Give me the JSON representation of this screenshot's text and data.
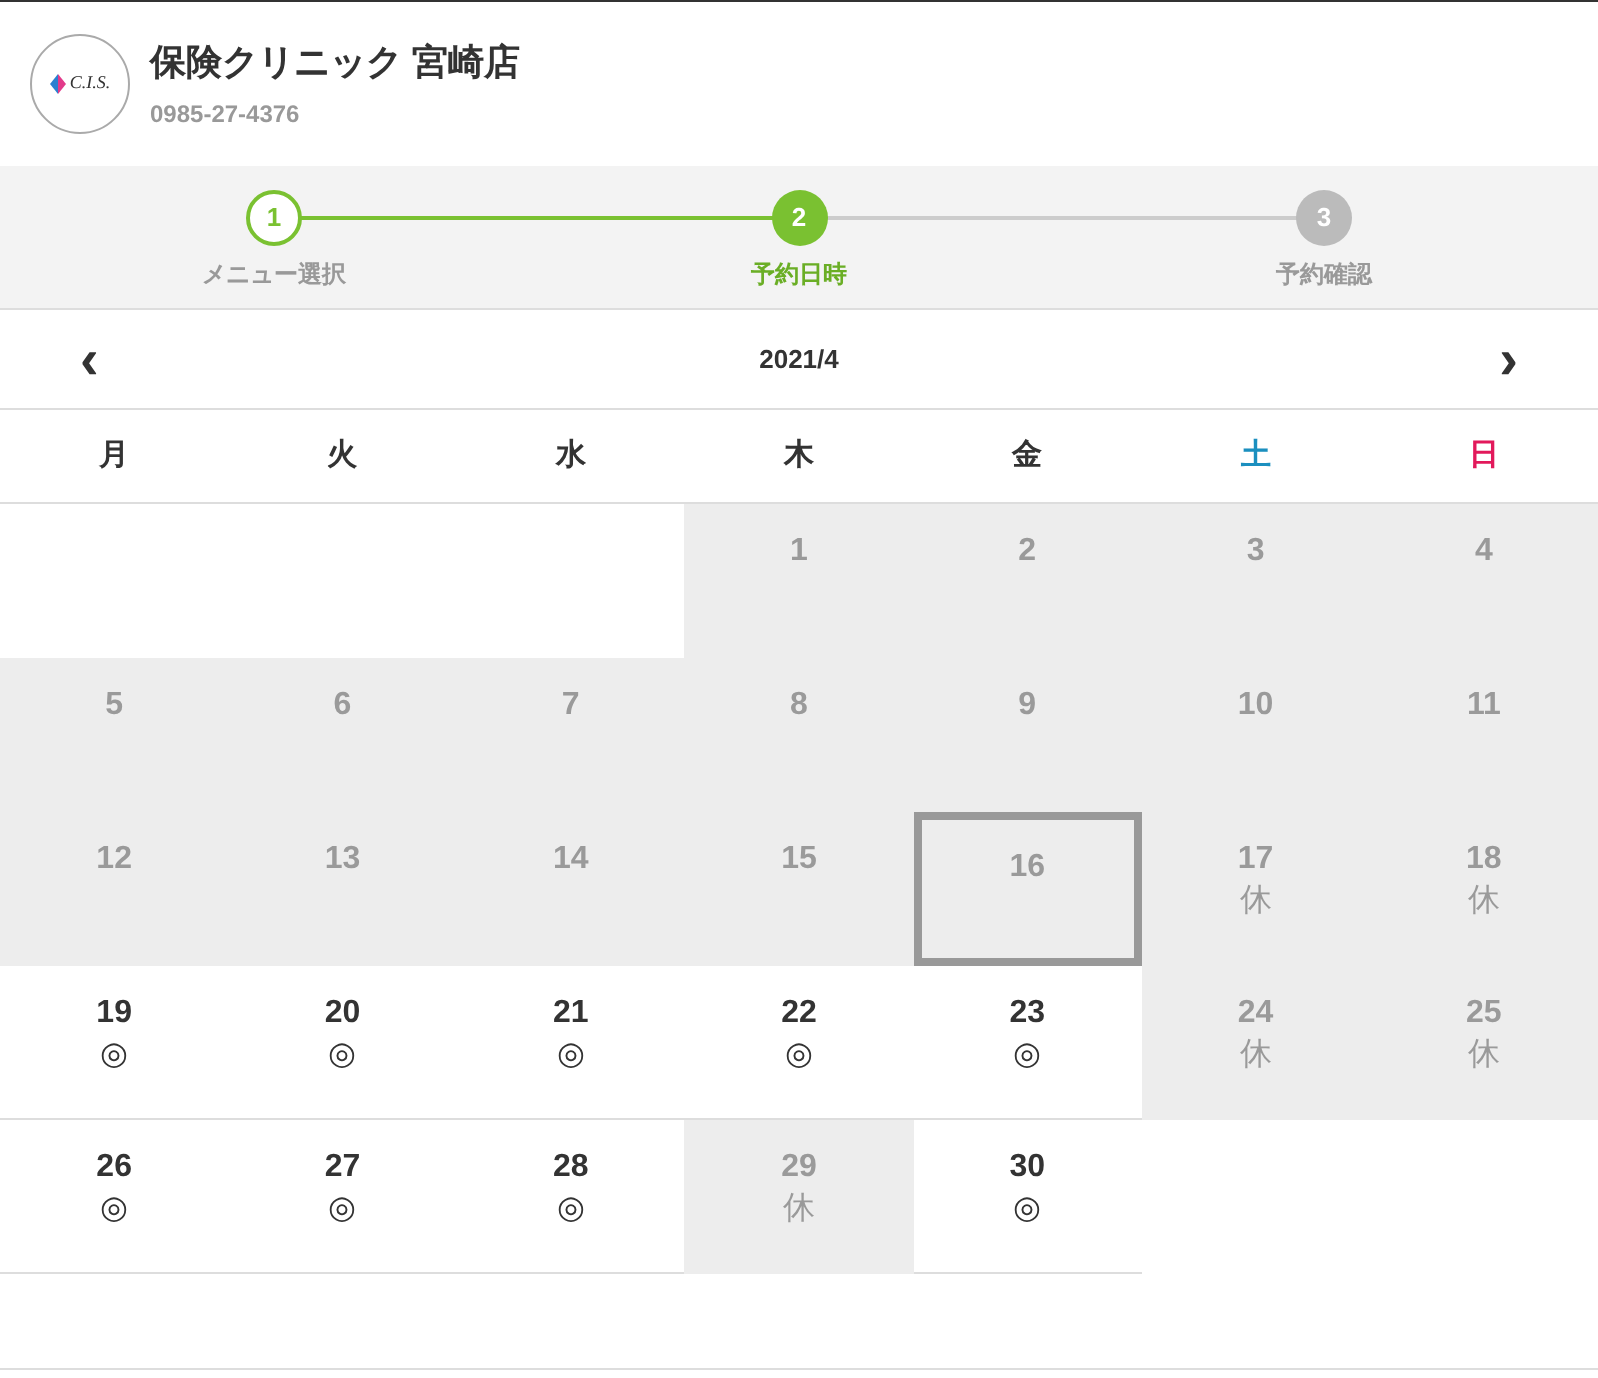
{
  "header": {
    "logo_text": "C.I.S.",
    "title": "保険クリニック 宮崎店",
    "phone": "0985-27-4376"
  },
  "steps": [
    {
      "number": "1",
      "label": "メニュー選択",
      "done": true,
      "selected": false
    },
    {
      "number": "2",
      "label": "予約日時",
      "done": false,
      "selected": true
    },
    {
      "number": "3",
      "label": "予約確認",
      "done": false,
      "selected": false
    }
  ],
  "month": {
    "prev": "‹",
    "label": "2021/4",
    "next": "›"
  },
  "weekdays": [
    {
      "label": "月",
      "kind": "weekday"
    },
    {
      "label": "火",
      "kind": "weekday"
    },
    {
      "label": "水",
      "kind": "weekday"
    },
    {
      "label": "木",
      "kind": "weekday"
    },
    {
      "label": "金",
      "kind": "weekday"
    },
    {
      "label": "土",
      "kind": "saturday"
    },
    {
      "label": "日",
      "kind": "sunday"
    }
  ],
  "weeks": [
    [
      {
        "kind": "empty"
      },
      {
        "kind": "empty"
      },
      {
        "kind": "empty"
      },
      {
        "kind": "closed",
        "day": "1",
        "today": false
      },
      {
        "kind": "closed",
        "day": "2",
        "today": false
      },
      {
        "kind": "closed",
        "day": "3",
        "today": false
      },
      {
        "kind": "closed",
        "day": "4",
        "today": false
      }
    ],
    [
      {
        "kind": "closed",
        "day": "5",
        "today": false
      },
      {
        "kind": "closed",
        "day": "6",
        "today": false
      },
      {
        "kind": "closed",
        "day": "7",
        "today": false
      },
      {
        "kind": "closed",
        "day": "8",
        "today": false
      },
      {
        "kind": "closed",
        "day": "9",
        "today": false
      },
      {
        "kind": "closed",
        "day": "10",
        "today": false
      },
      {
        "kind": "closed",
        "day": "11",
        "today": false
      }
    ],
    [
      {
        "kind": "closed",
        "day": "12",
        "today": false
      },
      {
        "kind": "closed",
        "day": "13",
        "today": false
      },
      {
        "kind": "closed",
        "day": "14",
        "today": false
      },
      {
        "kind": "closed",
        "day": "15",
        "today": false
      },
      {
        "kind": "closed",
        "day": "16",
        "today": true
      },
      {
        "kind": "holiday",
        "day": "17",
        "mark": "休",
        "today": false
      },
      {
        "kind": "holiday",
        "day": "18",
        "mark": "休",
        "today": false
      }
    ],
    [
      {
        "kind": "open",
        "day": "19",
        "mark": "◎",
        "today": false
      },
      {
        "kind": "open",
        "day": "20",
        "mark": "◎",
        "today": false
      },
      {
        "kind": "open",
        "day": "21",
        "mark": "◎",
        "today": false
      },
      {
        "kind": "open",
        "day": "22",
        "mark": "◎",
        "today": false
      },
      {
        "kind": "open",
        "day": "23",
        "mark": "◎",
        "today": false
      },
      {
        "kind": "holiday",
        "day": "24",
        "mark": "休",
        "today": false
      },
      {
        "kind": "holiday",
        "day": "25",
        "mark": "休",
        "today": false
      }
    ],
    [
      {
        "kind": "open",
        "day": "26",
        "mark": "◎",
        "today": false
      },
      {
        "kind": "open",
        "day": "27",
        "mark": "◎",
        "today": false
      },
      {
        "kind": "open",
        "day": "28",
        "mark": "◎",
        "today": false
      },
      {
        "kind": "holiday",
        "day": "29",
        "mark": "休",
        "today": false
      },
      {
        "kind": "open",
        "day": "30",
        "mark": "◎",
        "today": false
      },
      {
        "kind": "empty"
      },
      {
        "kind": "empty"
      }
    ]
  ]
}
